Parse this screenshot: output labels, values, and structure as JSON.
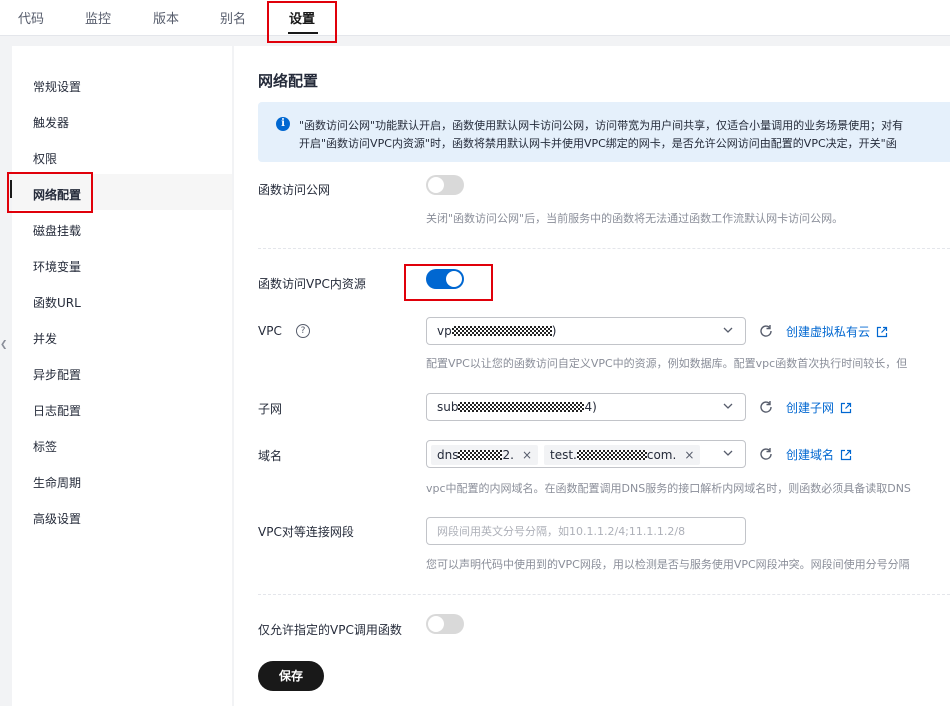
{
  "tabs": [
    "代码",
    "监控",
    "版本",
    "别名",
    "设置"
  ],
  "sidebar": {
    "items": [
      "常规设置",
      "触发器",
      "权限",
      "网络配置",
      "磁盘挂载",
      "环境变量",
      "函数URL",
      "并发",
      "异步配置",
      "日志配置",
      "标签",
      "生命周期",
      "高级设置"
    ]
  },
  "main": {
    "title": "网络配置",
    "info_line1": "\"函数访问公网\"功能默认开启，函数使用默认网卡访问公网，访问带宽为用户间共享，仅适合小量调用的业务场景使用；对有",
    "info_line2": "开启\"函数访问VPC内资源\"时，函数将禁用默认网卡并使用VPC绑定的网卡，是否允许公网访问由配置的VPC决定，开关\"函",
    "public_access": {
      "label": "函数访问公网",
      "enabled": false,
      "desc": "关闭\"函数访问公网\"后，当前服务中的函数将无法通过函数工作流默认网卡访问公网。"
    },
    "vpc_access": {
      "label": "函数访问VPC内资源",
      "enabled": true
    },
    "vpc": {
      "label": "VPC",
      "help": "?",
      "value_prefix": "vp",
      "value_suffix": ")",
      "link": "创建虚拟私有云",
      "desc": "配置VPC以让您的函数访问自定义VPC中的资源，例如数据库。配置vpc函数首次执行时间较长，但"
    },
    "subnet": {
      "label": "子网",
      "value_prefix": "sub",
      "value_suffix": "4)",
      "link": "创建子网"
    },
    "domain": {
      "label": "域名",
      "chips": [
        {
          "prefix": "dns",
          "suffix": "2."
        },
        {
          "prefix": "test.",
          "suffix": "com."
        }
      ],
      "link": "创建域名",
      "desc": "vpc中配置的内网域名。在函数配置调用DNS服务的接口解析内网域名时，则函数必须具备读取DNS"
    },
    "peering": {
      "label": "VPC对等连接网段",
      "placeholder": "网段间用英文分号分隔，如10.1.1.2/4;11.1.1.2/8",
      "desc": "您可以声明代码中使用到的VPC网段，用以检测是否与服务使用VPC网段冲突。网段间使用分号分隔"
    },
    "restrict_vpc": {
      "label": "仅允许指定的VPC调用函数",
      "enabled": false
    },
    "save_label": "保存"
  },
  "colors": {
    "accent": "#0067d1",
    "highlight_box": "#e0000a",
    "primary_button": "#191919"
  }
}
